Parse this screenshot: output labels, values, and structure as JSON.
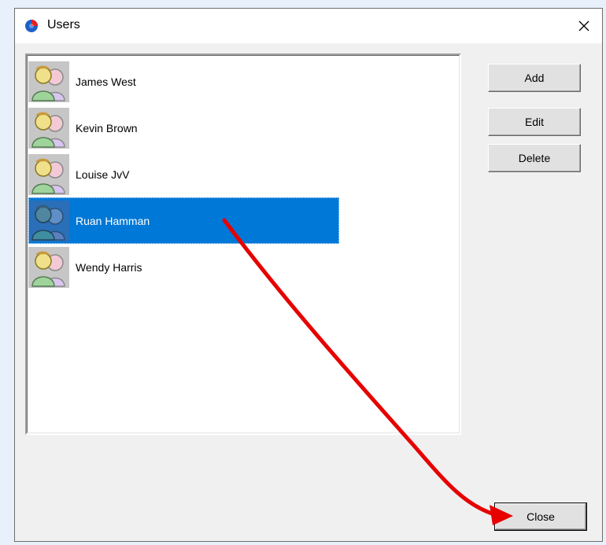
{
  "window": {
    "title": "Users",
    "close_glyph": "✕",
    "app_icon": "app-logo-icon"
  },
  "users": [
    {
      "name": "James West",
      "selected": false
    },
    {
      "name": "Kevin Brown",
      "selected": false
    },
    {
      "name": "Louise JvV",
      "selected": false
    },
    {
      "name": "Ruan Hamman",
      "selected": true
    },
    {
      "name": "Wendy Harris",
      "selected": false
    }
  ],
  "buttons": {
    "add": "Add",
    "edit": "Edit",
    "delete": "Delete",
    "close": "Close"
  },
  "annotation": {
    "arrow_color": "#e60000",
    "icon": "red-arrow-annotation"
  },
  "colors": {
    "selection": "#0078d7"
  }
}
